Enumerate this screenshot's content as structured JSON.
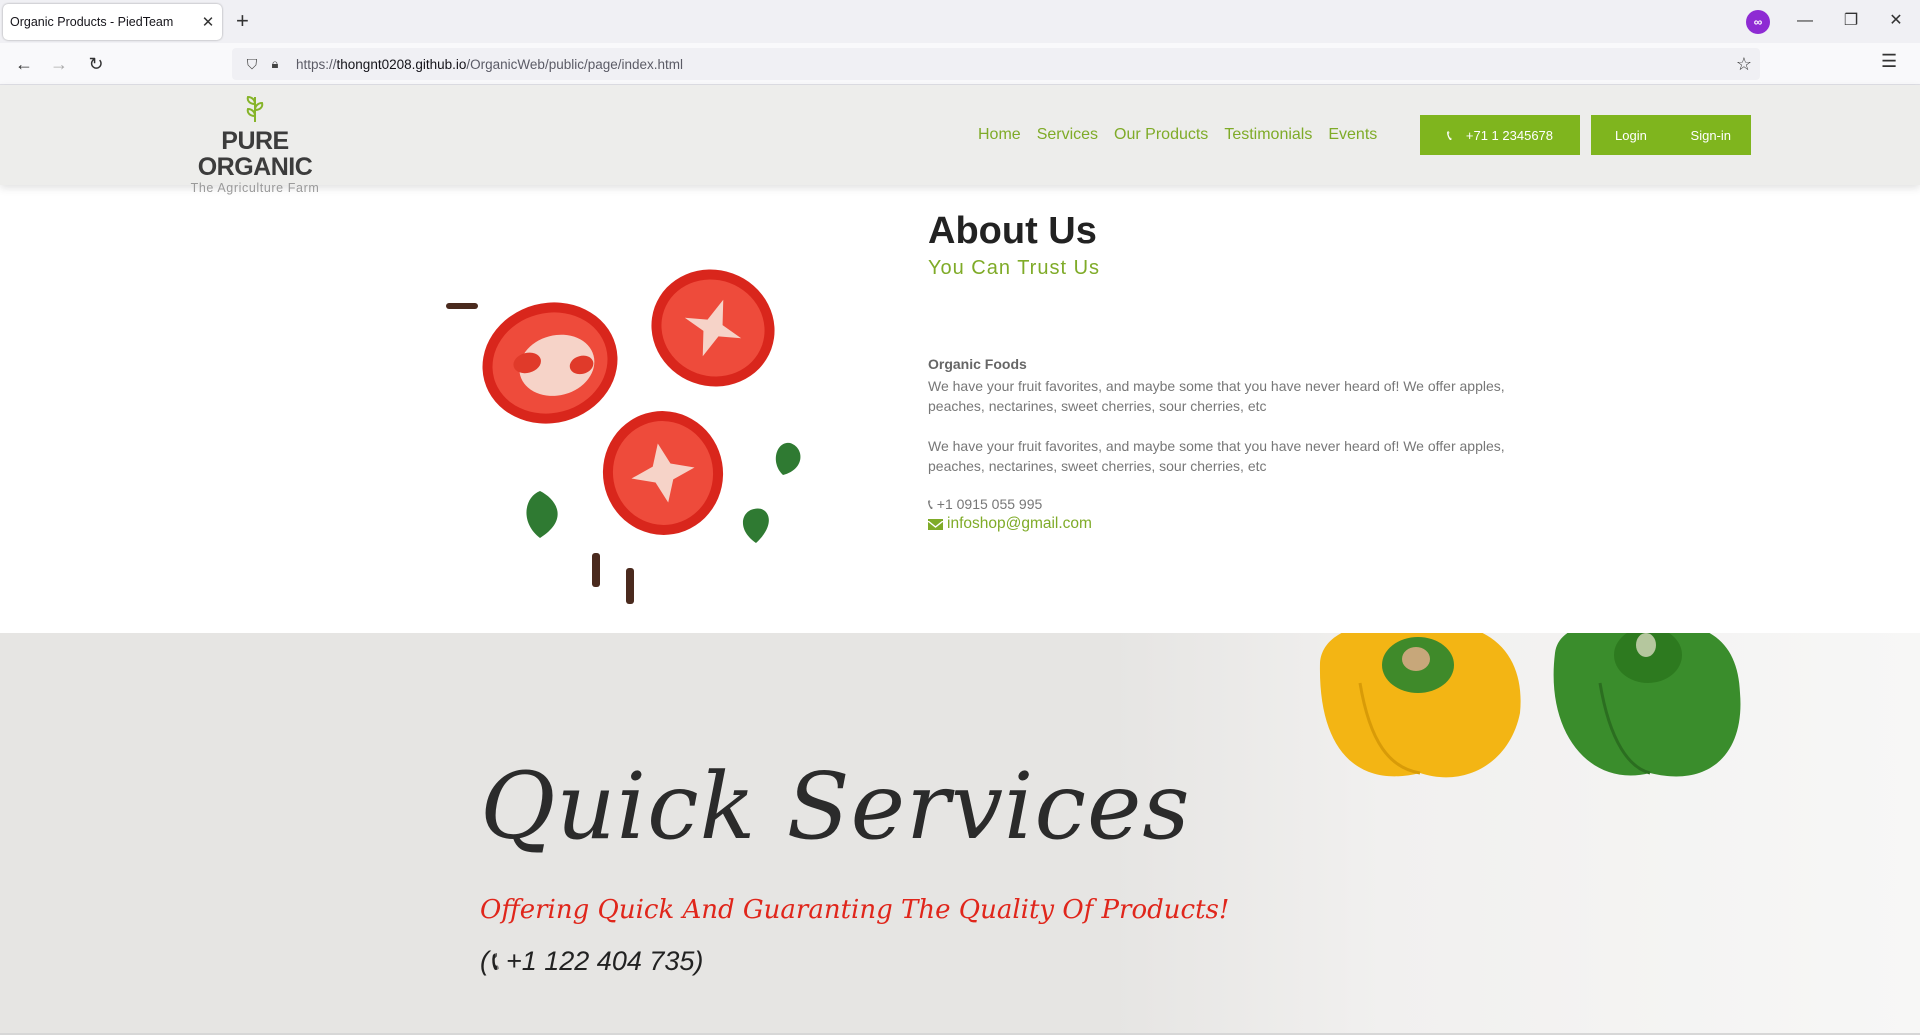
{
  "browser": {
    "tab_title": "Organic Products - PiedTeam",
    "url_prefix": "https://",
    "url_host": "thongnt0208.github.io",
    "url_path": "/OrganicWeb/public/page/index.html"
  },
  "header": {
    "logo_text": "PURE ORGANIC",
    "logo_tagline": "The Agriculture Farm",
    "nav": [
      "Home",
      "Services",
      "Our Products",
      "Testimonials",
      "Events"
    ],
    "phone_button": "+71 1 2345678",
    "login_label": "Login",
    "signin_label": "Sign-in"
  },
  "about": {
    "title": "About Us",
    "subtitle": "You Can Trust Us",
    "heading": "Organic Foods",
    "paragraph_1": "We have your fruit favorites, and maybe some that you have never heard of! We offer apples, peaches, nectarines, sweet cherries, sour cherries, etc",
    "paragraph_2": "We have your fruit favorites, and maybe some that you have never heard of! We offer apples, peaches, nectarines, sweet cherries, sour cherries, etc",
    "phone": "+1 0915 055 995",
    "email": "infoshop@gmail.com"
  },
  "quick_services": {
    "title": "Quick Services",
    "subtitle": "Offering Quick And Guaranting The Quality Of Products!",
    "phone": "+1 122 404 735"
  },
  "colors": {
    "brand_green": "#7fb51e",
    "accent_red": "#e0261b"
  }
}
